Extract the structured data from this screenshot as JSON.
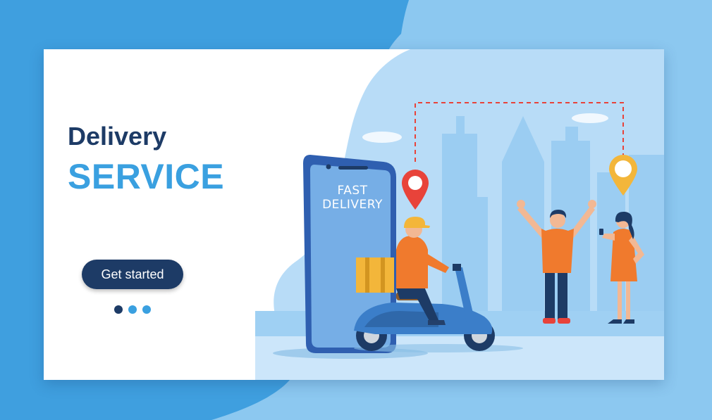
{
  "hero": {
    "title": "Delivery",
    "subtitle": "SERVICE",
    "cta_label": "Get started",
    "carousel": {
      "count": 3,
      "active_index": 0
    }
  },
  "illustration": {
    "phone_line_1": "FAST",
    "phone_line_2": "DELIVERY",
    "pin_icons": [
      "map-pin-red",
      "map-pin-yellow"
    ]
  },
  "colors": {
    "page_background": "#3f9fdf",
    "brand_navy": "#1d3b66",
    "accent_blue": "#3aa0e0",
    "pin_red": "#e8433a",
    "pin_yellow": "#f3b63a"
  }
}
